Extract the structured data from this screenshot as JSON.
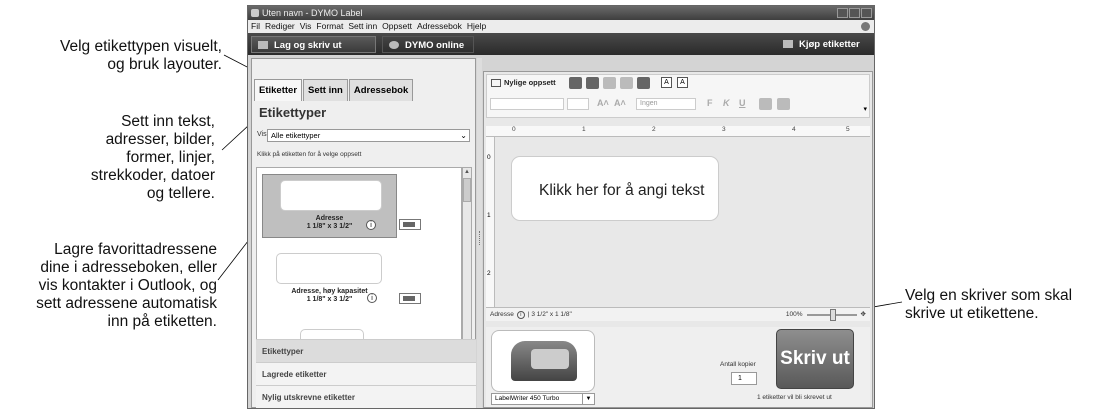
{
  "callouts": {
    "c1": "Velg etikettypen visuelt,\nog bruk layouter.",
    "c2": "Sett inn tekst,\nadresser, bilder,\nformer, linjer,\nstrekkoder, datoer\nog tellere.",
    "c3": "Lagre favorittadressene\ndine i adresseboken, eller\nvis kontakter i Outlook, og\nsett adressene automatisk\ninn på etiketten.",
    "c4": "Velg en skriver som skal\nskrive ut etikettene."
  },
  "window": {
    "title": "Uten navn - DYMO Label"
  },
  "menu": [
    "Fil",
    "Rediger",
    "Vis",
    "Format",
    "Sett inn",
    "Oppsett",
    "Adressebok",
    "Hjelp"
  ],
  "toolbar": {
    "primary": "Lag og skriv ut etiketter",
    "online": "DYMO online",
    "buy": "Kjøp etiketter"
  },
  "tabs": [
    "Etiketter",
    "Sett inn",
    "Adressebok"
  ],
  "left": {
    "title": "Etikettyper",
    "vis_label": "Vis",
    "vis_value": "Alle etikettyper",
    "hint": "Klikk på etiketten for å velge oppsett",
    "labels": [
      {
        "name": "Adresse",
        "size": "1 1/8\" x 3 1/2\""
      },
      {
        "name": "Adresse, høy kapasitet",
        "size": "1 1/8\" x 3 1/2\""
      }
    ],
    "sections": [
      "Etikettyper",
      "Lagrede etiketter",
      "Nylig utskrevne etiketter"
    ]
  },
  "editor": {
    "recent": "Nylige oppsett",
    "font_value": "Ingen",
    "fmt": [
      "F",
      "K",
      "U"
    ],
    "ruler": [
      "0",
      "1",
      "2",
      "3",
      "4",
      "5"
    ],
    "vruler": [
      "0",
      "1",
      "2"
    ],
    "placeholder": "Klikk her for å angi tekst",
    "status_label": "Adresse",
    "status_size": "3 1/2\" x 1 1/8\"",
    "zoom": "100%"
  },
  "print": {
    "printer": "LabelWriter 450 Turbo",
    "copies_label": "Antall kopier",
    "copies": "1",
    "button": "Skriv ut",
    "count": "1 etiketter vil bli skrevet ut"
  }
}
